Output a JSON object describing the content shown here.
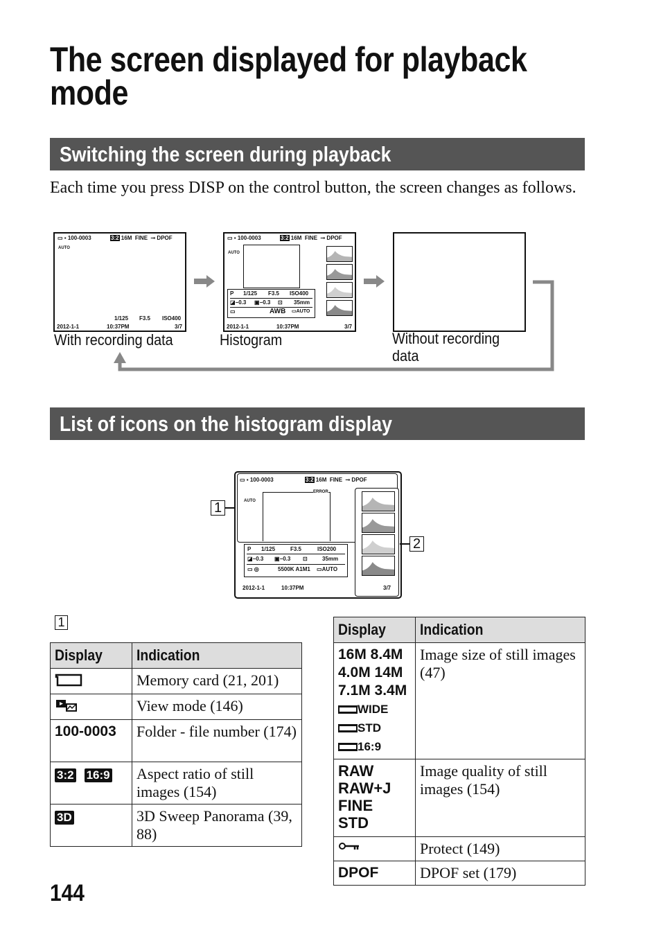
{
  "title": {
    "line1": "The screen displayed for playback",
    "line2": "mode"
  },
  "section1": {
    "heading": "Switching the screen during playback",
    "paragraph": "Each time you press DISP on the control button, the screen changes as follows.",
    "captions": {
      "with_data": "With recording data",
      "histogram": "Histogram",
      "without_data_1": "Without recording",
      "without_data_2": "data"
    }
  },
  "screen": {
    "folder_file": "100-0003",
    "aspect": "3:2",
    "size": "16M",
    "quality": "FINE",
    "dpof": "DPOF",
    "auto": "AUTO",
    "mode": "P",
    "shutter": "1/125",
    "aperture": "F3.5",
    "iso_400": "ISO400",
    "iso_200": "ISO200",
    "exposure": "−0.3",
    "flash": "−0.3",
    "focal": "35mm",
    "wb_awb": "AWB",
    "wb_kelvin": "5500K A1M1",
    "dro": "AUTO",
    "date": "2012-1-1",
    "time": "10:37PM",
    "count": "3/7",
    "error": "ERROR"
  },
  "section2": {
    "heading": "List of icons on the histogram display",
    "callout_1": "1",
    "callout_2": "2",
    "marker": "1"
  },
  "table_left": {
    "headers": [
      "Display",
      "Indication"
    ],
    "rows": [
      {
        "display_icon": "memory-card-icon",
        "indication": "Memory card (21, 201)"
      },
      {
        "display_icon": "view-mode-icon",
        "indication": "View mode (146)"
      },
      {
        "display": "100-0003",
        "indication": "Folder - file number (174)"
      },
      {
        "display": [
          "3:2",
          "16:9"
        ],
        "indication": "Aspect ratio of still images (154)"
      },
      {
        "display": "3D",
        "indication": "3D Sweep Panorama (39, 88)"
      }
    ]
  },
  "table_right": {
    "headers": [
      "Display",
      "Indication"
    ],
    "rows": [
      {
        "display": [
          "16M 8.4M",
          "4.0M 14M",
          "7.1M 3.4M",
          "WIDE",
          "STD",
          "16:9"
        ],
        "indication": "Image size of still images (47)"
      },
      {
        "display": [
          "RAW",
          "RAW+J",
          "FINE",
          "STD"
        ],
        "indication": "Image quality of still images (154)"
      },
      {
        "display_icon": "protect-key-icon",
        "indication": "Protect (149)"
      },
      {
        "display": "DPOF",
        "indication": "DPOF set (179)"
      }
    ]
  },
  "page_number": "144",
  "colors": {
    "section_bar": "#555555",
    "table_header": "#dddddd",
    "loop_arrow": "#888888"
  }
}
